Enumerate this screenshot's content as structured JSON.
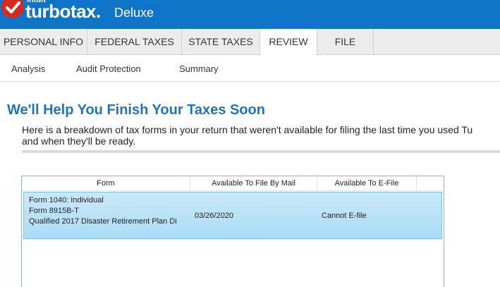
{
  "header": {
    "brand_small": "intuit",
    "brand": "turbotax.",
    "edition": "Deluxe",
    "colors": {
      "bar": "#0d74c8",
      "check": "#d52b1e"
    }
  },
  "tabs": [
    {
      "label": "PERSONAL INFO"
    },
    {
      "label": "FEDERAL TAXES"
    },
    {
      "label": "STATE TAXES"
    },
    {
      "label": "REVIEW",
      "active": true
    },
    {
      "label": "FILE"
    }
  ],
  "subnav": [
    {
      "label": "Analysis"
    },
    {
      "label": "Audit Protection"
    },
    {
      "label": "Summary"
    }
  ],
  "main": {
    "title": "We'll Help You Finish Your Taxes Soon",
    "description_line1": "Here is a breakdown of tax forms in your return that weren't available for filing the last time you used Tu",
    "description_line2": "and when they'll be ready."
  },
  "table": {
    "columns": [
      "Form",
      "Available To File By Mail",
      "Available To E-File"
    ],
    "rows": [
      {
        "form_line1": "Form 1040:  Individual",
        "form_line2": "Form 8915B-T",
        "form_line3": "Qualified 2017 Disaster Retirement Plan Di",
        "mail": "03/26/2020",
        "efile": "Cannot E-file"
      }
    ]
  }
}
